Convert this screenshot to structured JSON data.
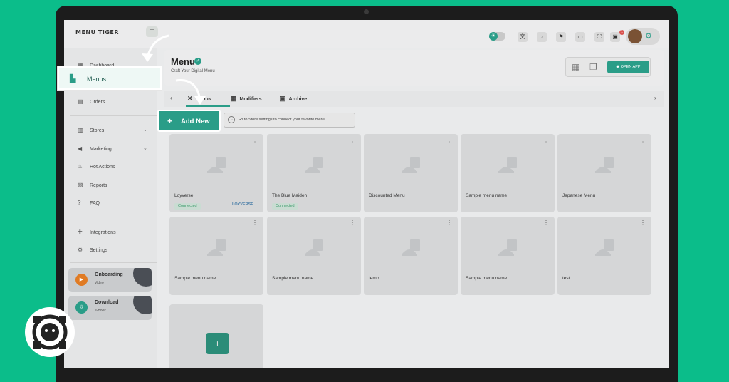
{
  "app": {
    "logo": "MENU TIGER"
  },
  "topbar": {
    "notification_count": "1"
  },
  "sidebar": {
    "items": [
      {
        "label": "Dashboard",
        "icon": "dashboard-icon"
      },
      {
        "label": "Menus",
        "icon": "menus-icon"
      },
      {
        "label": "Orders",
        "icon": "orders-icon"
      },
      {
        "label": "Stores",
        "icon": "stores-icon"
      },
      {
        "label": "Marketing",
        "icon": "marketing-icon"
      },
      {
        "label": "Hot Actions",
        "icon": "fire-icon"
      },
      {
        "label": "Reports",
        "icon": "reports-icon"
      },
      {
        "label": "FAQ",
        "icon": "faq-icon"
      },
      {
        "label": "Integrations",
        "icon": "puzzle-icon"
      },
      {
        "label": "Settings",
        "icon": "gear-icon"
      }
    ],
    "cards": [
      {
        "title": "Onboarding",
        "subtitle": "Video",
        "color": "#e07b24"
      },
      {
        "title": "Download",
        "subtitle": "e-Book",
        "color": "#2a9d88"
      }
    ]
  },
  "header": {
    "title": "Menu",
    "subtitle": "Craft Your Digital Menu",
    "open_app": "OPEN APP"
  },
  "tabs": [
    {
      "label": "Menus"
    },
    {
      "label": "Modifiers"
    },
    {
      "label": "Archive"
    }
  ],
  "actions": {
    "add_new": "Add New",
    "info": "Go to Store settings to connect your favorite menu"
  },
  "menu_items": [
    {
      "name": "Loyverse",
      "status": "Connected",
      "integration": "LOYVERSE"
    },
    {
      "name": "The Blue Maiden",
      "status": "Connected"
    },
    {
      "name": "Discounted Menu"
    },
    {
      "name": "Sample menu name"
    },
    {
      "name": "Japanese Menu"
    },
    {
      "name": "Sample menu name"
    },
    {
      "name": "Sample menu name"
    },
    {
      "name": "temp"
    },
    {
      "name": "Sample menu name ..."
    },
    {
      "name": "test"
    }
  ],
  "colors": {
    "accent": "#2a9d88",
    "background": "#0bbd8a"
  }
}
